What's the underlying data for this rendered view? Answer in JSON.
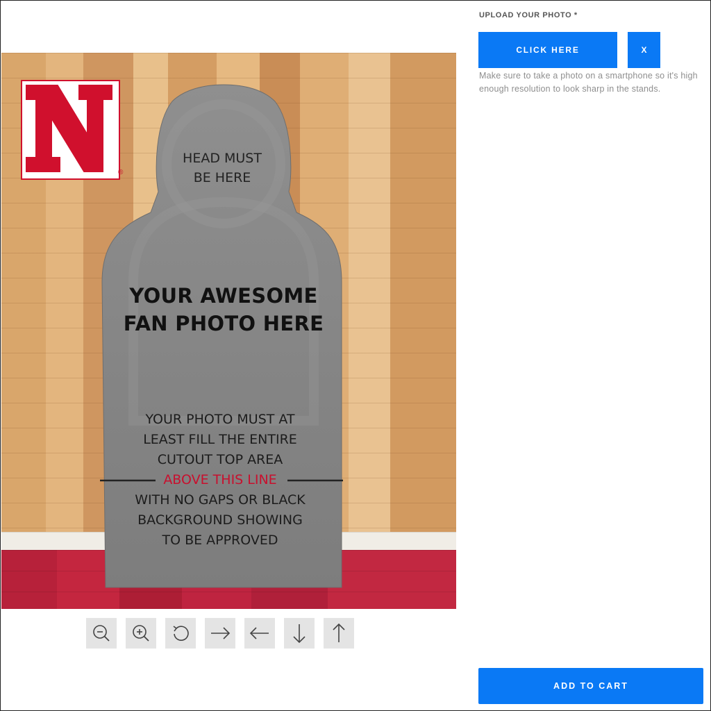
{
  "upload": {
    "label": "UPLOAD YOUR PHOTO *",
    "click_label": "CLICK HERE",
    "remove_label": "X",
    "help_text": "Make sure to take a photo on a smartphone so it's high enough resolution to look sharp in the stands."
  },
  "cart": {
    "add_label": "ADD TO CART"
  },
  "preview": {
    "logo_mark": "®",
    "head_text_line1": "HEAD MUST",
    "head_text_line2": "BE HERE",
    "big_text_line1": "YOUR AWESOME",
    "big_text_line2": "FAN PHOTO HERE",
    "info_line1": "YOUR PHOTO MUST AT",
    "info_line2": "LEAST FILL THE ENTIRE",
    "info_line3": "CUTOUT TOP AREA",
    "info_line4": "ABOVE THIS LINE",
    "info_line5": "WITH NO GAPS OR BLACK",
    "info_line6": "BACKGROUND SHOWING",
    "info_line7": "TO BE APPROVED"
  },
  "tools": [
    {
      "icon": "zoom-out-icon"
    },
    {
      "icon": "zoom-in-icon"
    },
    {
      "icon": "rotate-icon"
    },
    {
      "icon": "arrow-right-icon"
    },
    {
      "icon": "arrow-left-icon"
    },
    {
      "icon": "arrow-down-icon"
    },
    {
      "icon": "arrow-up-icon"
    }
  ],
  "colors": {
    "accent": "#0a79f5",
    "brand_red": "#c8102e",
    "cutout_gray": "#8a8a8a"
  }
}
